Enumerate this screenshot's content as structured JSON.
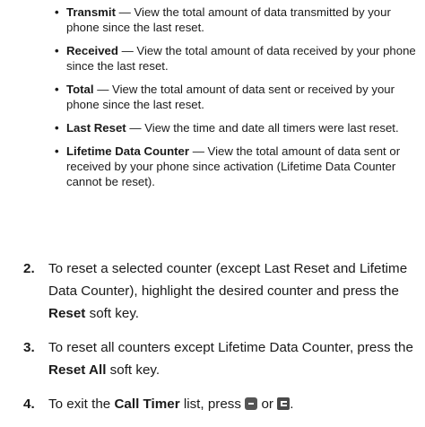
{
  "bullets": [
    {
      "term": "Transmit",
      "text": " — View the total amount of data transmitted by your phone since the last reset."
    },
    {
      "term": "Received",
      "text": " — View the total amount of data received by your phone since the last reset."
    },
    {
      "term": "Total",
      "text": " — View the total amount of data sent or received by your phone since the last reset."
    },
    {
      "term": "Last Reset",
      "text": " — View the time and date all timers were last reset."
    },
    {
      "term": "Lifetime Data Counter",
      "text": " — View the total amount of data sent or received by your phone since activation (Lifetime Data Counter cannot be reset)."
    }
  ],
  "steps": [
    {
      "num": "2.",
      "pre": "To reset a selected counter (except Last Reset and Lifetime Data Counter), highlight the desired counter and press the ",
      "bold": "Reset",
      "post": " soft key."
    },
    {
      "num": "3.",
      "pre": "To reset all counters except Lifetime Data Counter, press the ",
      "bold": "Reset All",
      "post": " soft key."
    },
    {
      "num": "4.",
      "pre": "To exit the ",
      "bold": "Call Timer",
      "post": " list, press",
      "or": "or",
      "end": "."
    }
  ],
  "icons": {
    "ok_key": "ok-key-icon",
    "end_key": "end-key-icon"
  }
}
